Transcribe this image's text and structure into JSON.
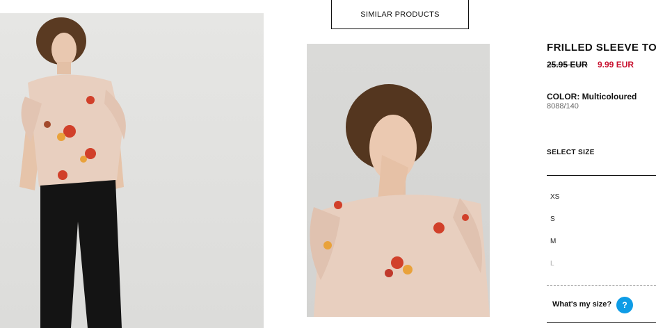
{
  "product": {
    "title": "FRILLED SLEEVE TOP",
    "price_old": "25.95 EUR",
    "price_new": "9.99 EUR",
    "color_label": "COLOR:",
    "color_value": "Multicoloured",
    "reference": "8088/140"
  },
  "similar_products_label": "SIMILAR PRODUCTS",
  "size_selector": {
    "label": "SELECT SIZE",
    "sizes": [
      "XS",
      "S",
      "M",
      "L"
    ],
    "help_text": "What's my size?",
    "help_icon": "?"
  },
  "colors": {
    "sale_price": "#c8102e",
    "help_icon_bg": "#0e9ce6"
  }
}
